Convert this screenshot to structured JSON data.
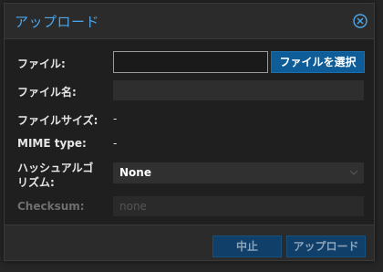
{
  "dialog": {
    "title": "アップロード",
    "close_icon": "close-circle-icon",
    "accent_color": "#4ea6ea"
  },
  "form": {
    "file_label": "ファイル:",
    "file_value": "",
    "select_file_button": "ファイルを選択",
    "filename_label": "ファイル名:",
    "filename_value": "",
    "filesize_label": "ファイルサイズ:",
    "filesize_value": "-",
    "mime_label": "MIME type:",
    "mime_value": "-",
    "hash_label_line1": "ハッシュアルゴ",
    "hash_label_line2": "リズム:",
    "hash_selected": "None",
    "checksum_label": "Checksum:",
    "checksum_placeholder": "none"
  },
  "footer": {
    "cancel_button": "中止",
    "upload_button": "アップロード"
  }
}
